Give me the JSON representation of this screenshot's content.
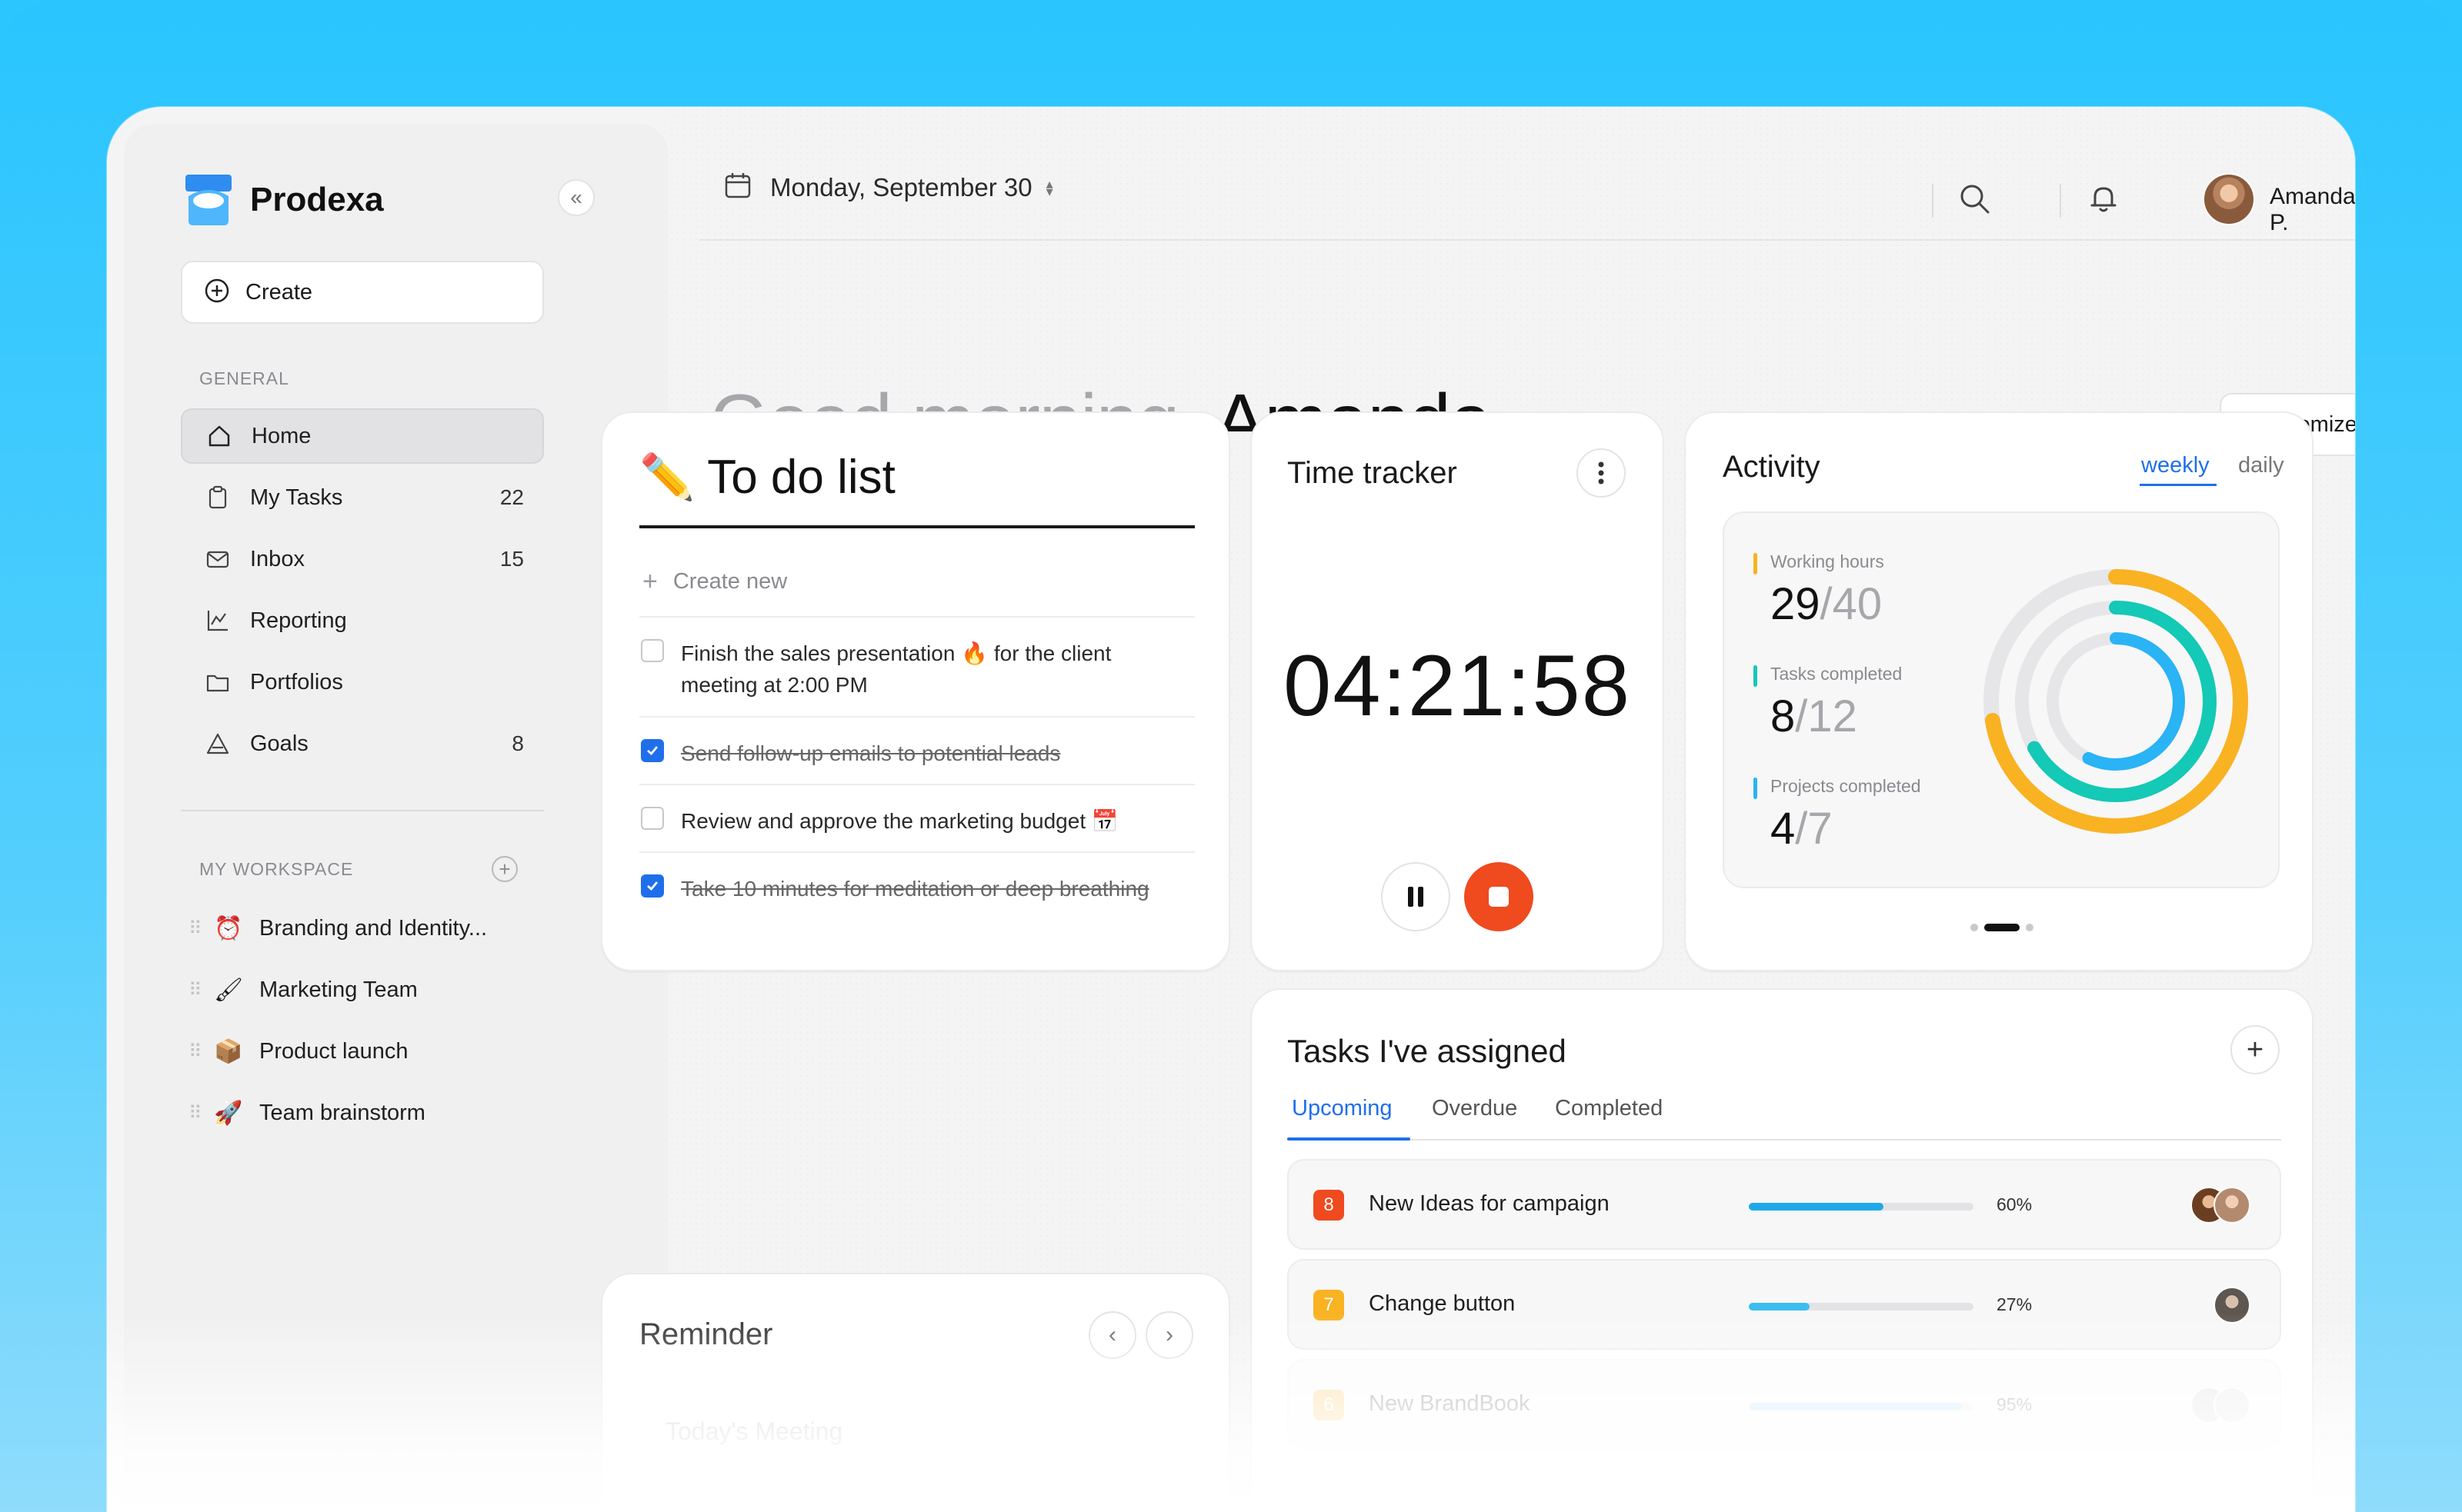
{
  "app": {
    "name": "Prodexa"
  },
  "sidebar": {
    "create_label": "Create",
    "general_label": "GENERAL",
    "nav": [
      {
        "label": "Home",
        "count": "",
        "icon": "home-icon",
        "active": true
      },
      {
        "label": "My Tasks",
        "count": "22",
        "icon": "clipboard-icon"
      },
      {
        "label": "Inbox",
        "count": "15",
        "icon": "mail-icon"
      },
      {
        "label": "Reporting",
        "count": "",
        "icon": "chart-icon"
      },
      {
        "label": "Portfolios",
        "count": "",
        "icon": "folder-icon"
      },
      {
        "label": "Goals",
        "count": "8",
        "icon": "goal-icon"
      }
    ],
    "workspace_label": "MY WORKSPACE",
    "workspace": [
      {
        "label": "Branding and Identity...",
        "emoji": "⏰"
      },
      {
        "label": "Marketing Team",
        "emoji": "🖌"
      },
      {
        "label": "Product launch",
        "emoji": "📦"
      },
      {
        "label": "Team brainstorm",
        "emoji": "🚀"
      }
    ]
  },
  "header": {
    "date": "Monday, September 30",
    "user_name": "Amanda P."
  },
  "greeting": {
    "prefix": "Good morning,",
    "name": "Amanda"
  },
  "customize_label": "Customize",
  "todo": {
    "emoji": "✏️",
    "title": "To do list",
    "create_new": "Create new",
    "items": [
      {
        "text": "Finish the sales presentation 🔥 for the client meeting at 2:00 PM",
        "done": false
      },
      {
        "text": "Send follow-up emails to potential leads",
        "done": true
      },
      {
        "text": "Review and approve the marketing budget 📅",
        "done": false
      },
      {
        "text": "Take 10 minutes for meditation or deep breathing",
        "done": true
      }
    ]
  },
  "reminder": {
    "title": "Reminder",
    "item": "Today's Meeting"
  },
  "time_tracker": {
    "title": "Time tracker",
    "time": "04:21:58"
  },
  "activity": {
    "title": "Activity",
    "tabs": [
      "weekly",
      "daily"
    ],
    "active_tab": "weekly",
    "stats": [
      {
        "label": "Working hours",
        "value": "29",
        "total": "/40",
        "color": "#f9b222",
        "fraction": 0.725
      },
      {
        "label": "Tasks completed",
        "value": "8",
        "total": "/12",
        "color": "#14c9b5",
        "fraction": 0.667
      },
      {
        "label": "Projects completed",
        "value": "4",
        "total": "/7",
        "color": "#2ab3f5",
        "fraction": 0.571
      }
    ]
  },
  "tasks_assigned": {
    "title": "Tasks I've assigned",
    "tabs": [
      "Upcoming",
      "Overdue",
      "Completed"
    ],
    "active_tab": "Upcoming",
    "rows": [
      {
        "num": "8",
        "name": "New Ideas for campaign",
        "progress": 0.6,
        "pct": "60%",
        "num_color": "#f04a1f",
        "bar_color": "#1fa8ea"
      },
      {
        "num": "7",
        "name": "Change button",
        "progress": 0.27,
        "pct": "27%",
        "num_color": "#f9b222",
        "bar_color": "#3cbdf0"
      },
      {
        "num": "6",
        "name": "New BrandBook",
        "progress": 0.95,
        "pct": "95%",
        "num_color": "#f9b222",
        "bar_color": "#8fd6f4"
      }
    ]
  }
}
